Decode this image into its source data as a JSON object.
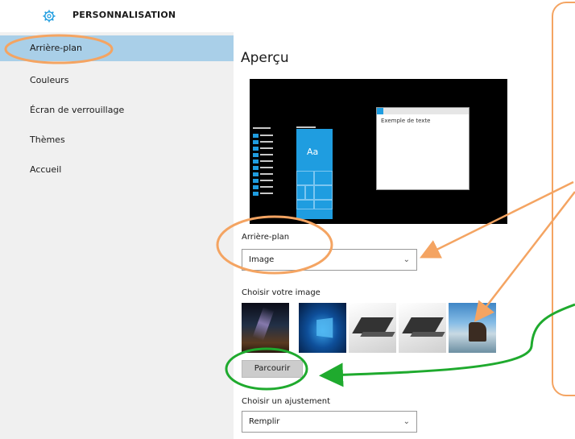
{
  "header": {
    "title": "PERSONNALISATION",
    "icon": "gear-icon"
  },
  "sidebar": {
    "items": [
      {
        "label": "Arrière-plan",
        "active": true
      },
      {
        "label": "Couleurs",
        "active": false
      },
      {
        "label": "Écran de verrouillage",
        "active": false
      },
      {
        "label": "Thèmes",
        "active": false
      },
      {
        "label": "Accueil",
        "active": false
      }
    ]
  },
  "main": {
    "preview_heading": "Aperçu",
    "preview": {
      "start_tile_text": "Aa",
      "window_text": "Exemple de texte"
    },
    "background": {
      "label": "Arrière-plan",
      "value": "Image"
    },
    "choose_image": {
      "label": "Choisir votre image",
      "thumbnails": [
        "night-sky-image",
        "windows-logo-image",
        "laptop-image",
        "laptop-image",
        "coastal-rock-image"
      ],
      "browse_label": "Parcourir"
    },
    "fit": {
      "label": "Choisir un ajustement",
      "value": "Remplir"
    }
  },
  "colors": {
    "accent": "#1f9de0",
    "sidebar_active": "#a9cfe8",
    "annotation_orange": "#f4a462",
    "annotation_green": "#1faa2e"
  }
}
